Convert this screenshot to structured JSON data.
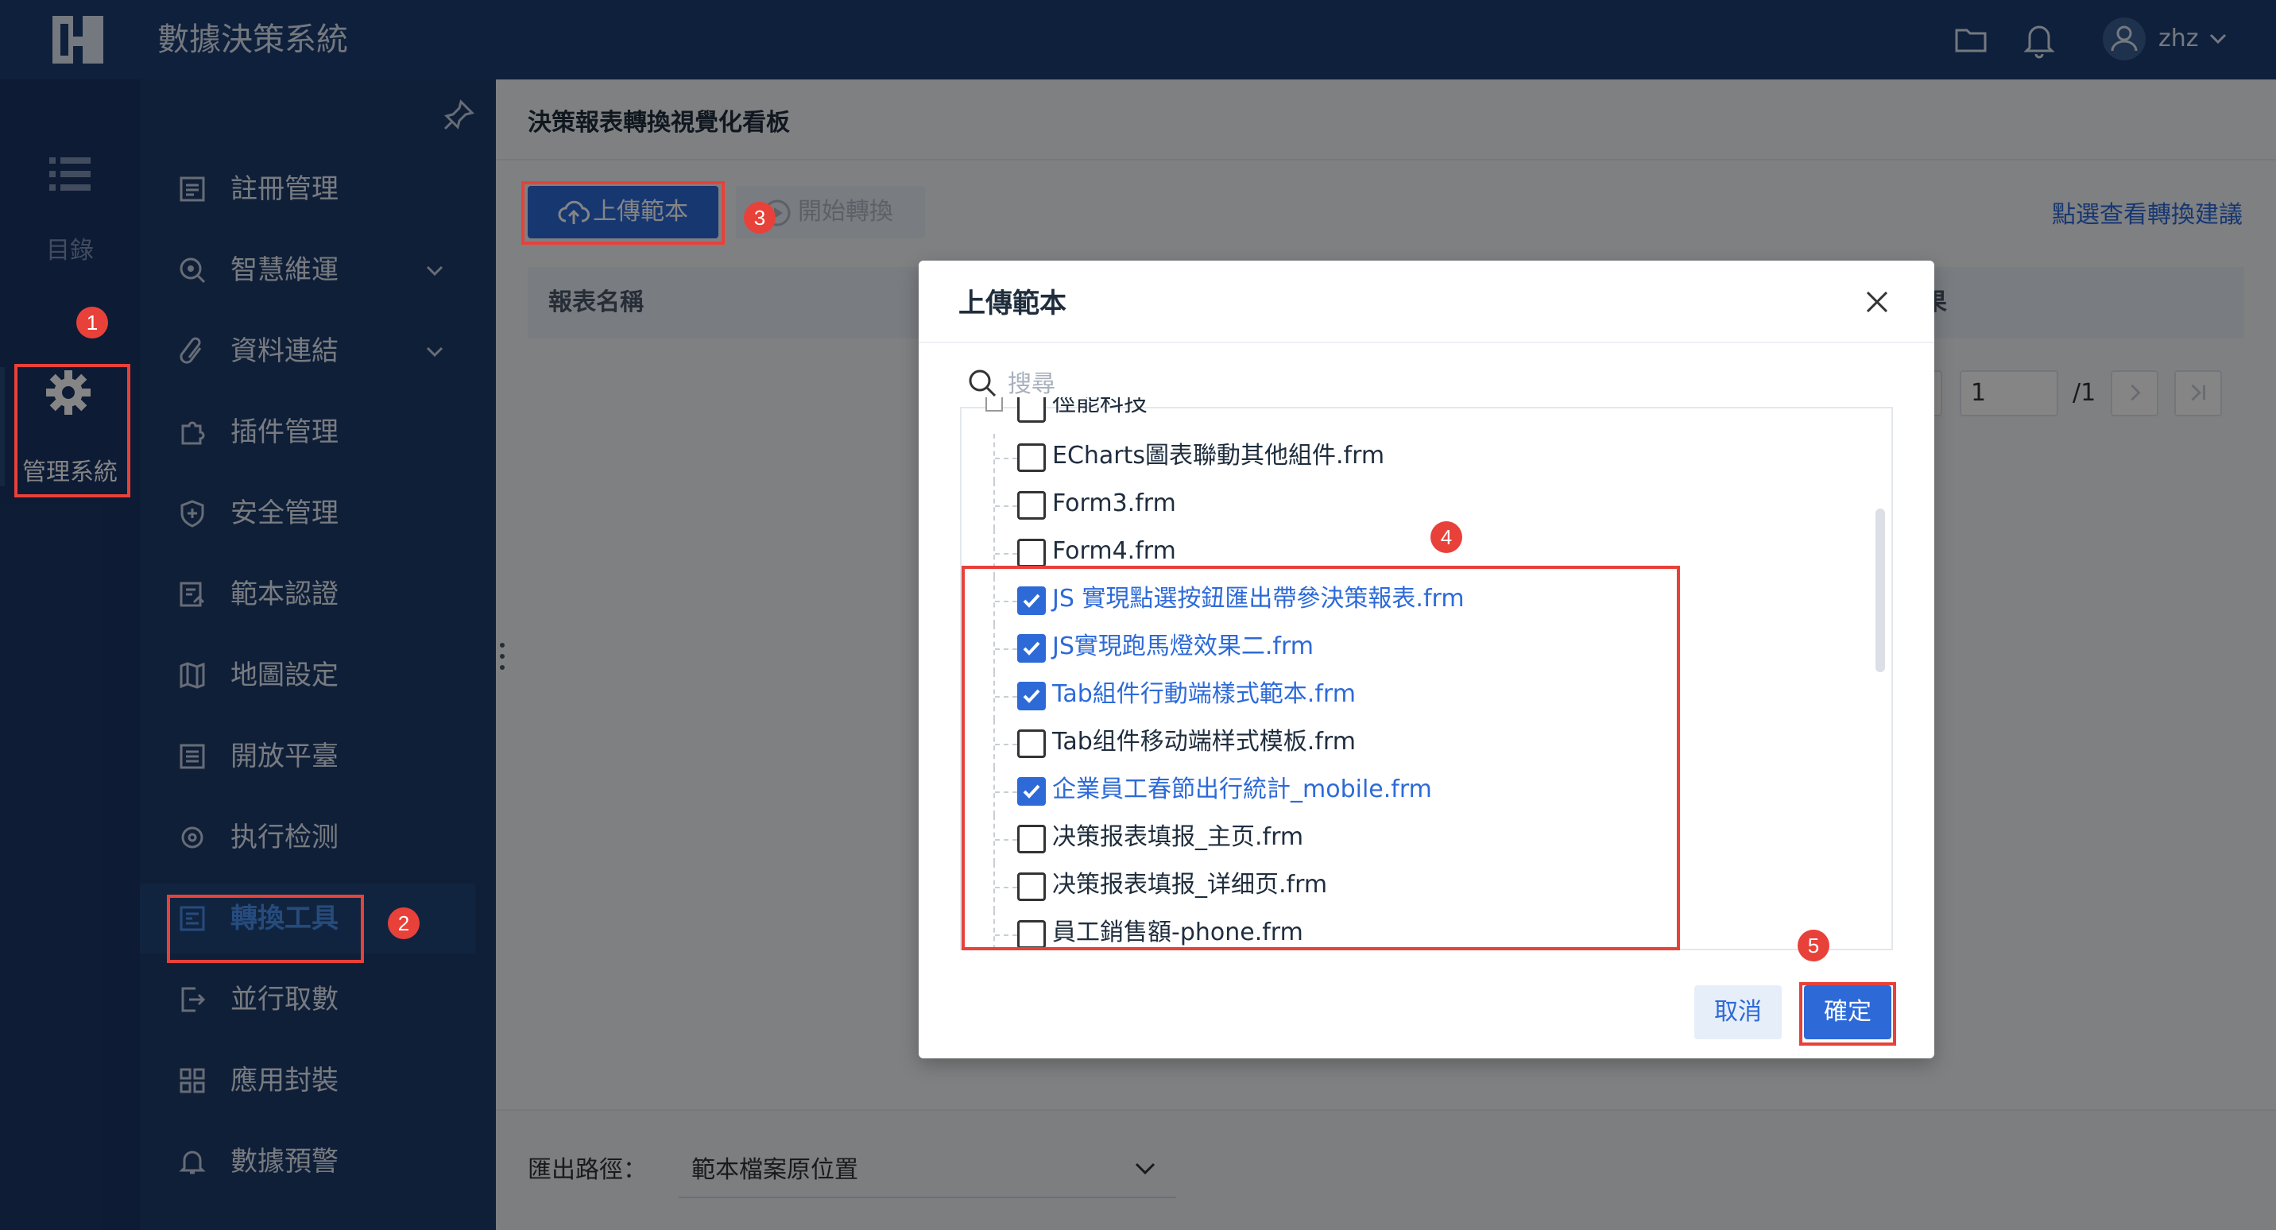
{
  "app": {
    "title": "數據決策系統",
    "user": "zhz"
  },
  "rail": {
    "catalog_label": "目錄",
    "mgmt_label": "管理系統"
  },
  "menu": [
    {
      "label": "註冊管理",
      "icon": "register-icon"
    },
    {
      "label": "智慧維運",
      "icon": "ops-icon",
      "expandable": true
    },
    {
      "label": "資料連結",
      "icon": "link-icon",
      "expandable": true
    },
    {
      "label": "插件管理",
      "icon": "plugin-icon"
    },
    {
      "label": "安全管理",
      "icon": "shield-icon"
    },
    {
      "label": "範本認證",
      "icon": "cert-icon"
    },
    {
      "label": "地圖設定",
      "icon": "map-icon"
    },
    {
      "label": "開放平臺",
      "icon": "platform-icon"
    },
    {
      "label": "执行检测",
      "icon": "gear-check-icon"
    },
    {
      "label": "轉換工具",
      "icon": "convert-icon",
      "active": true
    },
    {
      "label": "並行取數",
      "icon": "export-icon"
    },
    {
      "label": "應用封裝",
      "icon": "grid-icon"
    },
    {
      "label": "數據預警",
      "icon": "alert-bell-icon"
    }
  ],
  "page": {
    "title": "決策報表轉換視覺化看板",
    "upload_label": "上傳範本",
    "start_label": "開始轉換",
    "advice_link": "點選查看轉換建議",
    "col_name": "報表名稱",
    "col_result": "果",
    "pager_current": "1",
    "pager_total": "/1",
    "export_label": "匯出路徑：",
    "export_value": "範本檔案原位置"
  },
  "dialog": {
    "title": "上傳範本",
    "search_placeholder": "搜尋",
    "items": [
      {
        "label": "徑能科技",
        "checked": false
      },
      {
        "label": "ECharts圖表聯動其他組件.frm",
        "checked": false
      },
      {
        "label": "Form3.frm",
        "checked": false
      },
      {
        "label": "Form4.frm",
        "checked": false
      },
      {
        "label": "JS 實現點選按鈕匯出帶參決策報表.frm",
        "checked": true
      },
      {
        "label": "JS實現跑馬燈效果二.frm",
        "checked": true
      },
      {
        "label": "Tab組件行動端樣式範本.frm",
        "checked": true
      },
      {
        "label": "Tab组件移动端样式模板.frm",
        "checked": false
      },
      {
        "label": "企業員工春節出行統計_mobile.frm",
        "checked": true
      },
      {
        "label": "决策报表填报_主页.frm",
        "checked": false
      },
      {
        "label": "决策报表填报_详细页.frm",
        "checked": false
      },
      {
        "label": "員工銷售額-phone.frm",
        "checked": false
      }
    ],
    "cancel_label": "取消",
    "confirm_label": "確定"
  },
  "annotations": [
    "1",
    "2",
    "3",
    "4",
    "5"
  ],
  "colors": {
    "accent": "#2d6ad8",
    "highlight": "#e8413a",
    "topbar": "#1b3f72",
    "sidebar": "#1d3c6c"
  }
}
